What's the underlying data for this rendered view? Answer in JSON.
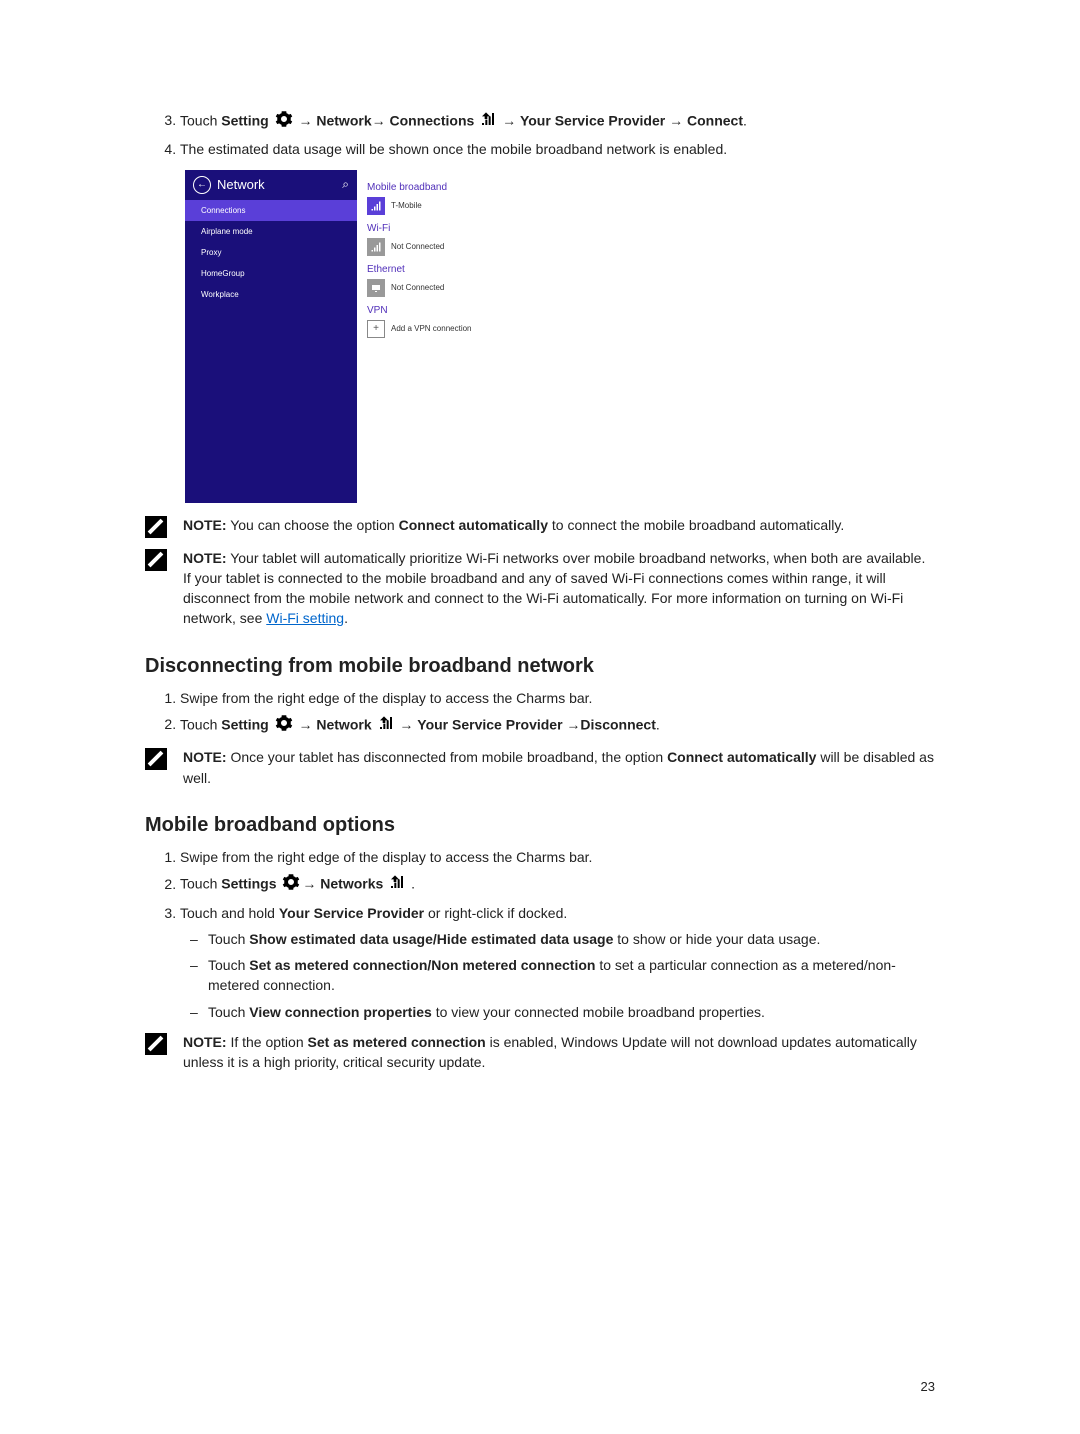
{
  "page_number": "23",
  "arrow": "→",
  "steps_top": {
    "start": 3,
    "item3_prefix": "Touch ",
    "item3_setting": "Setting",
    "item3_network": "Network",
    "item3_connections": "Connections",
    "item3_provider": "Your Service Provider",
    "item3_connect": "Connect",
    "item4": "The estimated data usage will be shown once the mobile broadband network is enabled."
  },
  "panel": {
    "title": "Network",
    "nav": {
      "connections": "Connections",
      "airplane": "Airplane mode",
      "proxy": "Proxy",
      "homegroup": "HomeGroup",
      "workplace": "Workplace"
    },
    "mobile": {
      "label": "Mobile broadband",
      "item": "T-Mobile"
    },
    "wifi": {
      "label": "Wi-Fi",
      "item": "Not Connected"
    },
    "ethernet": {
      "label": "Ethernet",
      "item": "Not Connected"
    },
    "vpn": {
      "label": "VPN",
      "item": "Add a VPN connection"
    }
  },
  "note1": {
    "label": "NOTE:",
    "pre": " You can choose the option ",
    "bold": "Connect automatically",
    "post": " to connect the mobile broadband automatically."
  },
  "note2": {
    "label": "NOTE:",
    "text": " Your tablet will automatically prioritize Wi-Fi networks over mobile broadband networks, when both are available. If your tablet is connected to the mobile broadband and any of saved Wi-Fi connections comes within range, it will disconnect from the mobile network and connect to the Wi-Fi automatically. For more information on turning on Wi-Fi network, see ",
    "link": "Wi-Fi setting"
  },
  "heading_disconnect": "Disconnecting from mobile broadband network",
  "disconnect_steps": {
    "item1": "Swipe from the right edge of the display to access the Charms bar.",
    "item2_prefix": "Touch ",
    "item2_setting": "Setting",
    "item2_network": "Network",
    "item2_provider": "Your Service Provider",
    "item2_disconnect": "Disconnect"
  },
  "note3": {
    "label": "NOTE:",
    "pre": " Once your tablet has disconnected from mobile broadband, the option ",
    "bold": "Connect automatically",
    "post": " will be disabled as well."
  },
  "heading_options": "Mobile broadband options",
  "options_steps": {
    "item1": "Swipe from the right edge of the display to access the Charms bar.",
    "item2_prefix": "Touch ",
    "item2_settings": "Settings",
    "item2_networks": "Networks",
    "item3_pre": "Touch and hold ",
    "item3_bold": "Your Service Provider",
    "item3_post": " or right-click if docked.",
    "sub1_pre": "Touch ",
    "sub1_bold": "Show estimated data usage/Hide estimated data usage",
    "sub1_post": " to show or hide your data usage.",
    "sub2_pre": "Touch ",
    "sub2_bold": "Set as metered connection/Non metered connection",
    "sub2_post": " to set a particular connection as a metered/non-metered connection.",
    "sub3_pre": "Touch ",
    "sub3_bold": "View connection properties",
    "sub3_post": " to view your connected mobile broadband properties."
  },
  "note4": {
    "label": "NOTE:",
    "pre": " If the option ",
    "bold": "Set as metered connection",
    "post": " is enabled, Windows Update will not download updates automatically unless it is a high priority, critical security update."
  }
}
